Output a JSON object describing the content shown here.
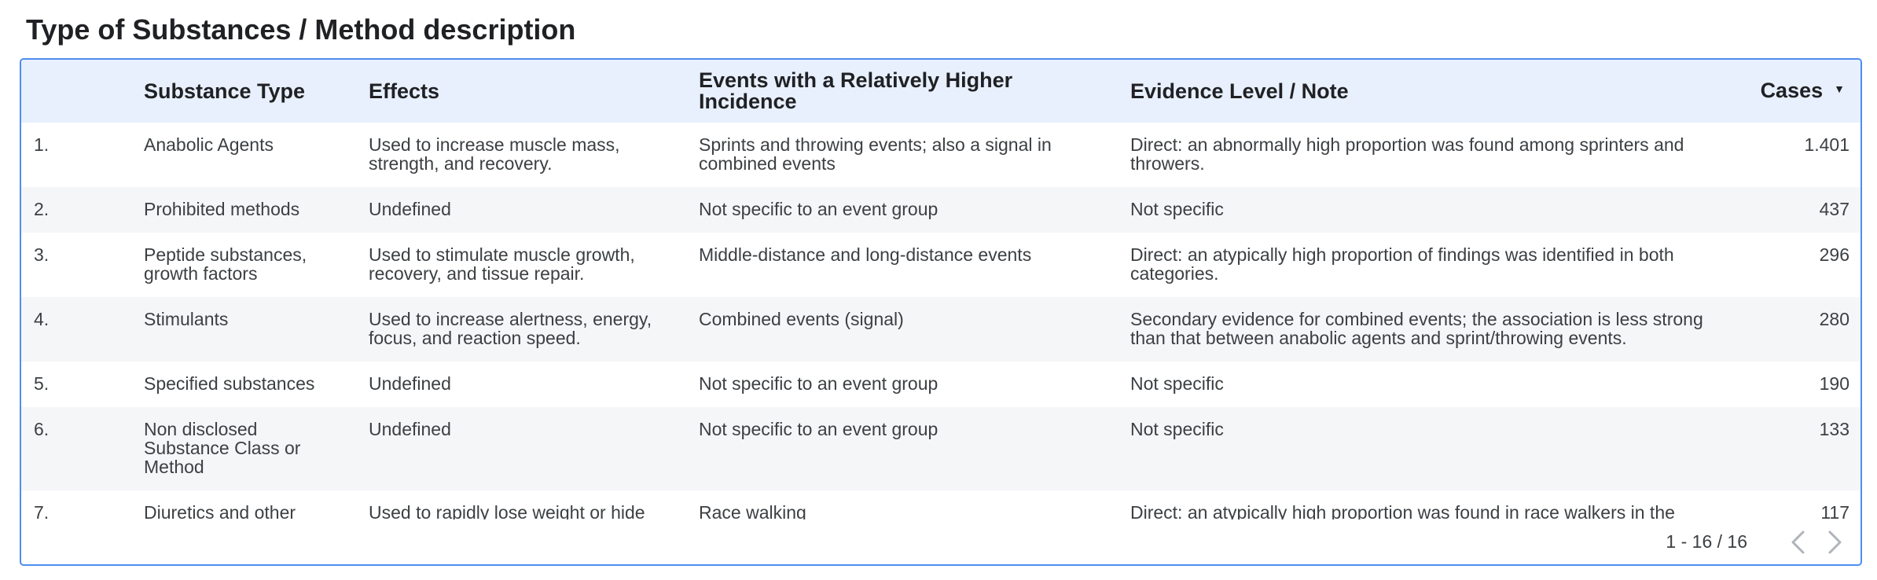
{
  "title": "Type of Substances / Method description",
  "table": {
    "headers": {
      "index": "",
      "substance_type": "Substance Type",
      "effects": "Effects",
      "events": "Events with a Relatively Higher Incidence",
      "evidence": "Evidence Level / Note",
      "cases": "Cases"
    },
    "sort_icon": "caret-down-icon",
    "rows": [
      {
        "index": "1.",
        "substance_type": "Anabolic Agents",
        "effects": "Used to increase muscle mass, strength, and recovery.",
        "events": "Sprints and throwing events; also a signal in combined events",
        "evidence": "Direct: an abnormally high proportion was found among sprinters and throwers.",
        "cases": "1.401"
      },
      {
        "index": "2.",
        "substance_type": "Prohibited methods",
        "effects": "Undefined",
        "events": "Not specific to an event group",
        "evidence": "Not specific",
        "cases": "437"
      },
      {
        "index": "3.",
        "substance_type": "Peptide substances, growth factors",
        "effects": "Used to stimulate muscle growth, recovery, and tissue repair.",
        "events": "Middle-distance and long-distance events",
        "evidence": "Direct: an atypically high proportion of findings was identified in both categories.",
        "cases": "296"
      },
      {
        "index": "4.",
        "substance_type": "Stimulants",
        "effects": "Used to increase alertness, energy, focus, and reaction speed.",
        "events": "Combined events (signal)",
        "evidence": "Secondary evidence for combined events; the association is less strong than that between anabolic agents and sprint/throwing events.",
        "cases": "280"
      },
      {
        "index": "5.",
        "substance_type": "Specified substances",
        "effects": "Undefined",
        "events": "Not specific to an event group",
        "evidence": "Not specific",
        "cases": "190"
      },
      {
        "index": "6.",
        "substance_type": "Non disclosed Substance Class or Method",
        "effects": "Undefined",
        "events": "Not specific to an event group",
        "evidence": "Not specific",
        "cases": "133"
      },
      {
        "index": "7.",
        "substance_type": "Diuretics and other",
        "effects": "Used to rapidly lose weight or hide",
        "events": "Race walking",
        "evidence": "Direct: an atypically high proportion was found in race walkers in the",
        "cases": "117"
      }
    ]
  },
  "pagination": {
    "range_text": "1 - 16 / 16",
    "prev_icon": "chevron-left-icon",
    "next_icon": "chevron-right-icon"
  }
}
